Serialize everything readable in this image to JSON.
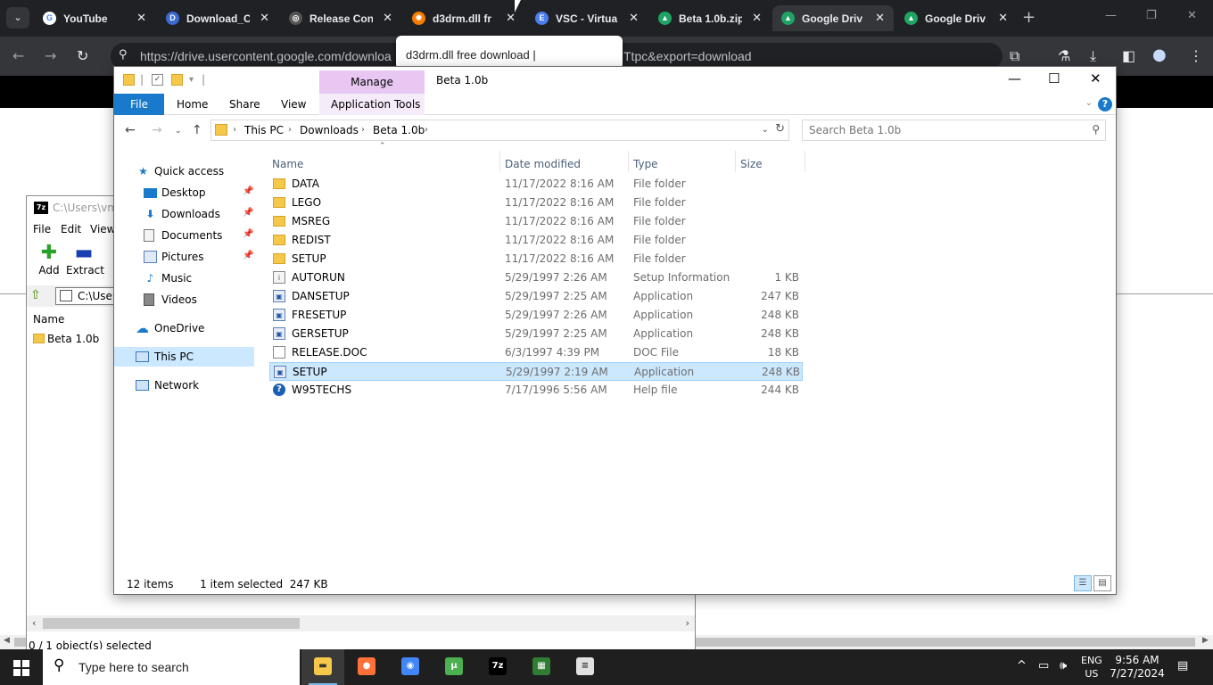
{
  "browser": {
    "tabs": [
      {
        "label": "YouTube",
        "color": "#ffffff",
        "glyph": "G"
      },
      {
        "label": "Download_C",
        "color": "#3b6bd1",
        "glyph": "D"
      },
      {
        "label": "Release Con",
        "color": "#555555",
        "glyph": "◎"
      },
      {
        "label": "d3drm.dll fr",
        "color": "#f57c00",
        "glyph": "✹"
      },
      {
        "label": "VSC - Virtua",
        "color": "#4a7df0",
        "glyph": "E"
      },
      {
        "label": "Beta 1.0b.zip",
        "color": "#1fa463",
        "glyph": "▲"
      },
      {
        "label": "Google Driv",
        "color": "#1fa463",
        "glyph": "▲"
      },
      {
        "label": "Google Driv",
        "color": "#1fa463",
        "glyph": "▲"
      }
    ],
    "url_visible": "https://drive.usercontent.google.com/downloa",
    "url_tail": "Ttpc&export=download",
    "tab_hover": "d3drm.dll free download |"
  },
  "zip_window": {
    "title": "C:\\Users\\vm",
    "menu": [
      "File",
      "Edit",
      "View"
    ],
    "tools": [
      {
        "label": "Add",
        "glyph": "✚",
        "color": "#2aa12a"
      },
      {
        "label": "Extract",
        "glyph": "▬",
        "color": "#1a3fb0"
      }
    ],
    "path": "C:\\Users",
    "column_name": "Name",
    "item": "Beta 1.0b",
    "status": "0 / 1 object(s) selected"
  },
  "explorer": {
    "ribbon_contextual": "Manage",
    "title": "Beta 1.0b",
    "ribbon_tabs": [
      "File",
      "Home",
      "Share",
      "View",
      "Application Tools"
    ],
    "breadcrumb": [
      "This PC",
      "Downloads",
      "Beta 1.0b"
    ],
    "search_placeholder": "Search Beta 1.0b",
    "nav": {
      "quick_access": "Quick access",
      "desktop": "Desktop",
      "downloads": "Downloads",
      "documents": "Documents",
      "pictures": "Pictures",
      "music": "Music",
      "videos": "Videos",
      "onedrive": "OneDrive",
      "this_pc": "This PC",
      "network": "Network"
    },
    "columns": {
      "name": "Name",
      "date": "Date modified",
      "type": "Type",
      "size": "Size"
    },
    "files": [
      {
        "name": "DATA",
        "date": "11/17/2022 8:16 AM",
        "type": "File folder",
        "size": "",
        "icon": "folder"
      },
      {
        "name": "LEGO",
        "date": "11/17/2022 8:16 AM",
        "type": "File folder",
        "size": "",
        "icon": "folder"
      },
      {
        "name": "MSREG",
        "date": "11/17/2022 8:16 AM",
        "type": "File folder",
        "size": "",
        "icon": "folder"
      },
      {
        "name": "REDIST",
        "date": "11/17/2022 8:16 AM",
        "type": "File folder",
        "size": "",
        "icon": "folder"
      },
      {
        "name": "SETUP",
        "date": "11/17/2022 8:16 AM",
        "type": "File folder",
        "size": "",
        "icon": "folder"
      },
      {
        "name": "AUTORUN",
        "date": "5/29/1997 2:26 AM",
        "type": "Setup Information",
        "size": "1 KB",
        "icon": "inf"
      },
      {
        "name": "DANSETUP",
        "date": "5/29/1997 2:25 AM",
        "type": "Application",
        "size": "247 KB",
        "icon": "app"
      },
      {
        "name": "FRESETUP",
        "date": "5/29/1997 2:26 AM",
        "type": "Application",
        "size": "248 KB",
        "icon": "app"
      },
      {
        "name": "GERSETUP",
        "date": "5/29/1997 2:25 AM",
        "type": "Application",
        "size": "248 KB",
        "icon": "app"
      },
      {
        "name": "RELEASE.DOC",
        "date": "6/3/1997 4:39 PM",
        "type": "DOC File",
        "size": "18 KB",
        "icon": "doc"
      },
      {
        "name": "SETUP",
        "date": "5/29/1997 2:19 AM",
        "type": "Application",
        "size": "248 KB",
        "icon": "app",
        "selected": true
      },
      {
        "name": "W95TECHS",
        "date": "7/17/1996 5:56 AM",
        "type": "Help file",
        "size": "244 KB",
        "icon": "help"
      }
    ],
    "status_items": "12 items",
    "status_selected": "1 item selected  247 KB"
  },
  "taskbar": {
    "search_placeholder": "Type here to search",
    "apps": [
      {
        "name": "file-explorer",
        "color": "#f5c84a",
        "glyph": "▬",
        "active": true
      },
      {
        "name": "firefox",
        "color": "#ff7139",
        "glyph": "●"
      },
      {
        "name": "chrome",
        "color": "#4285f4",
        "glyph": "◉"
      },
      {
        "name": "utorrent",
        "color": "#4caf50",
        "glyph": "µ"
      },
      {
        "name": "7zip",
        "color": "#000000",
        "glyph": "7z"
      },
      {
        "name": "network-card",
        "color": "#2e7d32",
        "glyph": "▦"
      },
      {
        "name": "notepad",
        "color": "#e0e0e0",
        "glyph": "≡"
      }
    ],
    "lang_top": "ENG",
    "lang_bottom": "US",
    "time": "9:56 AM",
    "date": "7/27/2024"
  }
}
